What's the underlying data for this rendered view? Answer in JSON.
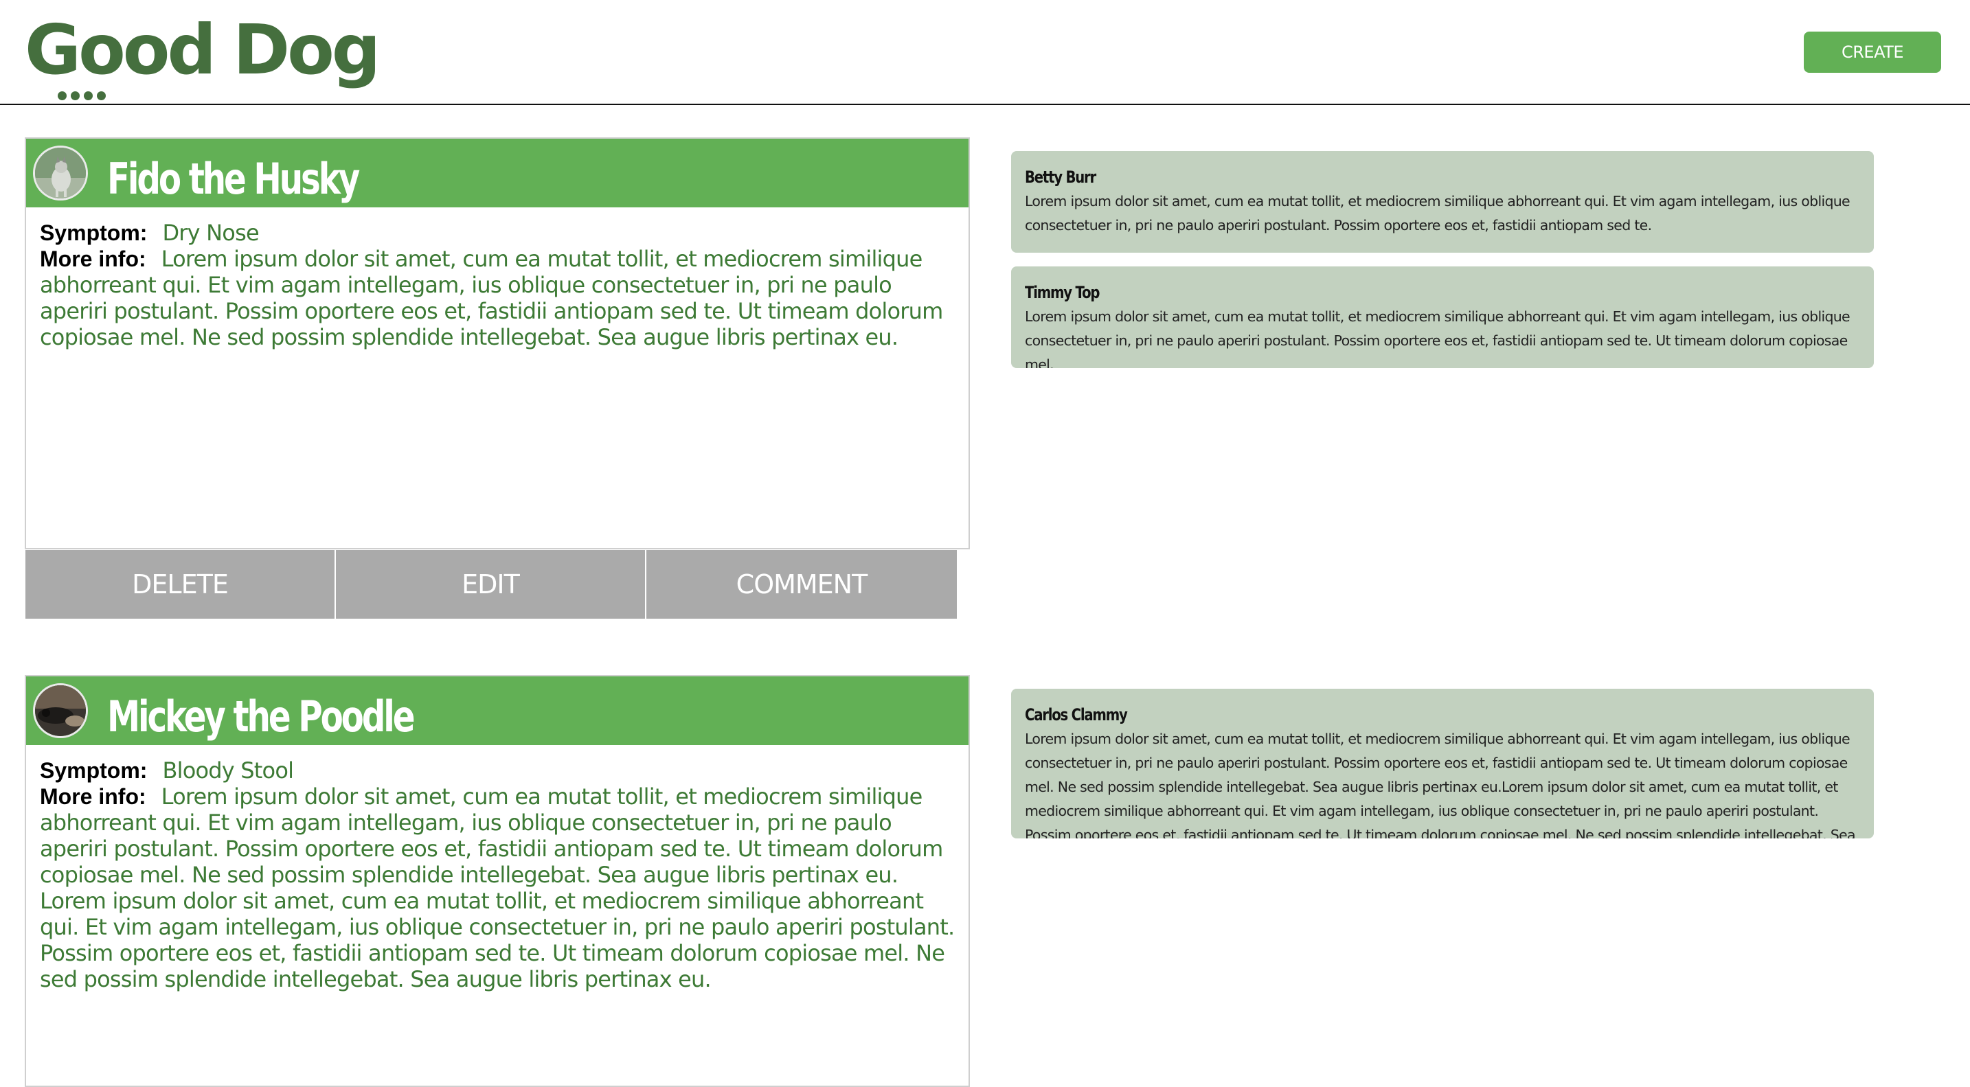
{
  "header": {
    "logo_word_1": "Good",
    "logo_word_2": "Dog",
    "create_label": "CREATE"
  },
  "colors": {
    "brand_green": "#62b055",
    "logo_green": "#456f3e",
    "comment_bg": "#c2d1bf",
    "action_gray": "#aaaaaa",
    "value_text_green": "#3d7a35"
  },
  "posts": [
    {
      "title": "Fido the Husky",
      "symptom_label": "Symptom:",
      "symptom": "Dry Nose",
      "info_label": "More info:",
      "info": "Lorem ipsum dolor sit amet, cum ea mutat tollit, et mediocrem similique abhorreant qui. Et vim agam intellegam, ius oblique consectetuer in, pri ne paulo aperiri postulant. Possim oportere eos et, fastidii antiopam sed te. Ut timeam dolorum copiosae mel. Ne sed possim splendide intellegebat. Sea augue libris pertinax eu.",
      "actions": {
        "delete": "DELETE",
        "edit": "EDIT",
        "comment": "COMMENT"
      },
      "comments": [
        {
          "author": "Betty Burr",
          "text": "Lorem ipsum dolor sit amet, cum ea mutat tollit, et mediocrem similique abhorreant qui. Et vim agam intellegam, ius oblique consectetuer in, pri ne paulo aperiri postulant. Possim oportere eos et, fastidii antiopam sed te."
        },
        {
          "author": "Timmy Top",
          "text": "Lorem ipsum dolor sit amet, cum ea mutat tollit, et mediocrem similique abhorreant qui. Et vim agam intellegam, ius oblique consectetuer in, pri ne paulo aperiri postulant. Possim oportere eos et, fastidii antiopam sed te. Ut timeam dolorum copiosae mel."
        }
      ]
    },
    {
      "title": "Mickey the Poodle",
      "symptom_label": "Symptom:",
      "symptom": "Bloody Stool",
      "info_label": "More info:",
      "info": "Lorem ipsum dolor sit amet, cum ea mutat tollit, et mediocrem similique abhorreant qui. Et vim agam intellegam, ius oblique consectetuer in, pri ne paulo aperiri postulant. Possim oportere eos et, fastidii antiopam sed te. Ut timeam dolorum copiosae mel. Ne sed possim splendide intellegebat. Sea augue libris pertinax eu. Lorem ipsum dolor sit amet, cum ea mutat tollit, et mediocrem similique abhorreant qui. Et vim agam intellegam, ius oblique consectetuer in, pri ne paulo aperiri postulant. Possim oportere eos et, fastidii antiopam sed te. Ut timeam dolorum copiosae mel. Ne sed possim splendide intellegebat. Sea augue libris pertinax eu.",
      "comments": [
        {
          "author": "Carlos Clammy",
          "text": "Lorem ipsum dolor sit amet, cum ea mutat tollit, et mediocrem similique abhorreant qui. Et vim agam intellegam, ius oblique consectetuer in, pri ne paulo aperiri postulant. Possim oportere eos et, fastidii antiopam sed te. Ut timeam dolorum copiosae mel. Ne sed possim splendide intellegebat. Sea augue libris pertinax eu.Lorem ipsum dolor sit amet, cum ea mutat tollit, et mediocrem similique abhorreant qui. Et vim agam intellegam, ius oblique consectetuer in, pri ne paulo aperiri postulant. Possim oportere eos et, fastidii antiopam sed te. Ut timeam dolorum copiosae mel. Ne sed possim splendide intellegebat. Sea augue libris pertinax eu."
        }
      ]
    }
  ]
}
